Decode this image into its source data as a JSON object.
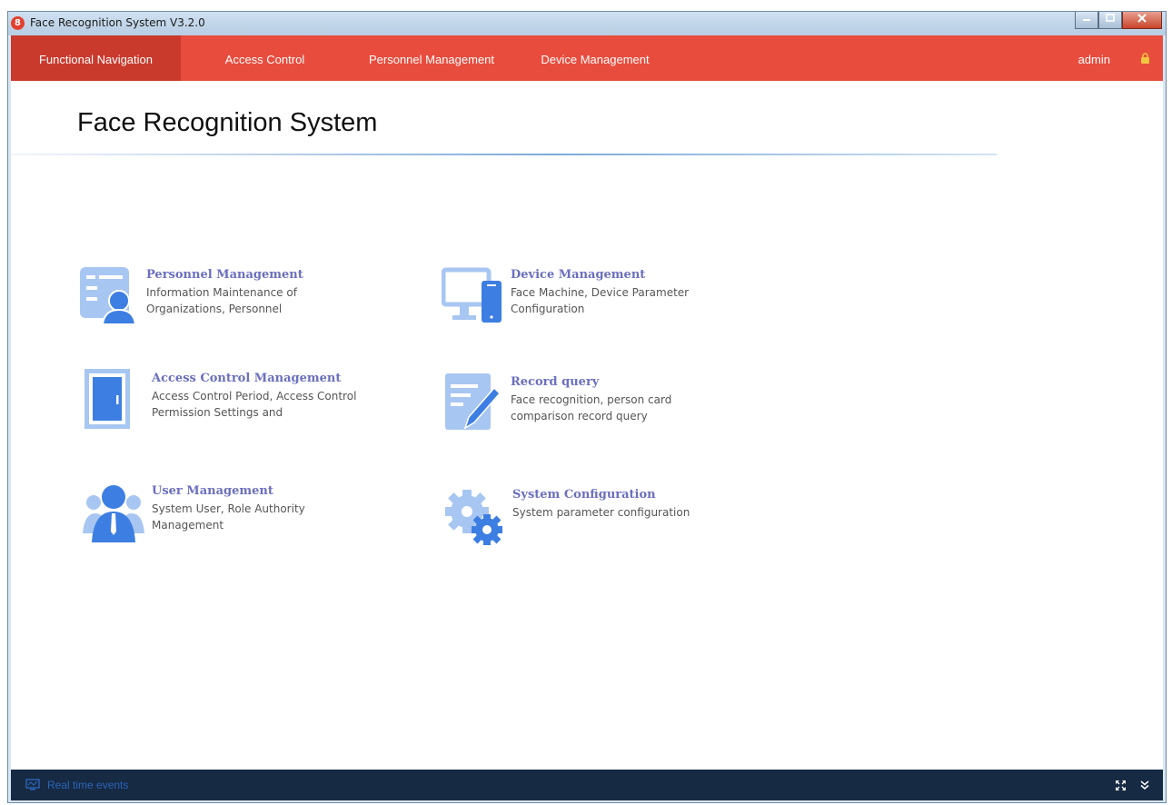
{
  "window": {
    "title": "Face Recognition System V3.2.0",
    "app_icon_glyph": "8"
  },
  "nav": {
    "items": [
      {
        "label": "Functional Navigation",
        "active": true
      },
      {
        "label": "Access Control"
      },
      {
        "label": "Personnel Management"
      },
      {
        "label": "Device Management"
      }
    ],
    "user": "admin"
  },
  "page": {
    "title": "Face Recognition System"
  },
  "cards": {
    "personnel": {
      "title": "Personnel Management",
      "desc": "Information Maintenance of Organizations, Personnel"
    },
    "device": {
      "title": "Device Management",
      "desc": "Face Machine, Device Parameter Configuration"
    },
    "access": {
      "title": "Access Control Management",
      "desc": "Access Control Period, Access Control Permission Settings and"
    },
    "record": {
      "title": "Record query",
      "desc": "Face recognition, person card comparison record query"
    },
    "user": {
      "title": "User Management",
      "desc": "System User, Role Authority Management"
    },
    "config": {
      "title": "System Configuration",
      "desc": "System parameter configuration"
    }
  },
  "bottom": {
    "realtime_label": "Real time events"
  },
  "colors": {
    "nav_bg": "#e84c3d",
    "nav_active": "#c93a2d",
    "card_title": "#6b6fc0",
    "icon_blue": "#3d7ee2",
    "icon_light": "#a8c6f2",
    "bottom_bg": "#172a44"
  }
}
